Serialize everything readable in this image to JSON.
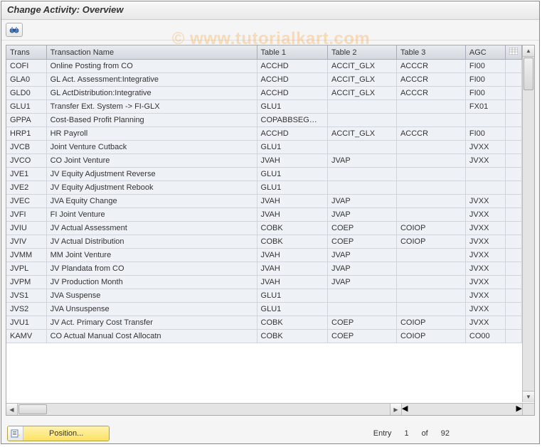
{
  "title": "Change Activity: Overview",
  "watermark": "© www.tutorialkart.com",
  "columns": {
    "trans": "Trans",
    "name": "Transaction Name",
    "t1": "Table 1",
    "t2": "Table 2",
    "t3": "Table 3",
    "agc": "AGC"
  },
  "rows": [
    {
      "trans": "COFI",
      "name": "Online Posting from CO",
      "t1": "ACCHD",
      "t2": "ACCIT_GLX",
      "t3": "ACCCR",
      "agc": "FI00"
    },
    {
      "trans": "GLA0",
      "name": "GL Act. Assessment:Integrative",
      "t1": "ACCHD",
      "t2": "ACCIT_GLX",
      "t3": "ACCCR",
      "agc": "FI00"
    },
    {
      "trans": "GLD0",
      "name": "GL ActDistribution:Integrative",
      "t1": "ACCHD",
      "t2": "ACCIT_GLX",
      "t3": "ACCCR",
      "agc": "FI00"
    },
    {
      "trans": "GLU1",
      "name": "Transfer Ext. System -> FI-GLX",
      "t1": "GLU1",
      "t2": "",
      "t3": "",
      "agc": "FX01"
    },
    {
      "trans": "GPPA",
      "name": "Cost-Based Profit Planning",
      "t1": "COPABBSEG…",
      "t2": "",
      "t3": "",
      "agc": ""
    },
    {
      "trans": "HRP1",
      "name": "HR Payroll",
      "t1": "ACCHD",
      "t2": "ACCIT_GLX",
      "t3": "ACCCR",
      "agc": "FI00"
    },
    {
      "trans": "JVCB",
      "name": "Joint Venture Cutback",
      "t1": "GLU1",
      "t2": "",
      "t3": "",
      "agc": "JVXX"
    },
    {
      "trans": "JVCO",
      "name": "CO Joint Venture",
      "t1": "JVAH",
      "t2": "JVAP",
      "t3": "",
      "agc": "JVXX"
    },
    {
      "trans": "JVE1",
      "name": "JV Equity Adjustment Reverse",
      "t1": "GLU1",
      "t2": "",
      "t3": "",
      "agc": ""
    },
    {
      "trans": "JVE2",
      "name": "JV Equity Adjustment Rebook",
      "t1": "GLU1",
      "t2": "",
      "t3": "",
      "agc": ""
    },
    {
      "trans": "JVEC",
      "name": "JVA Equity Change",
      "t1": "JVAH",
      "t2": "JVAP",
      "t3": "",
      "agc": "JVXX"
    },
    {
      "trans": "JVFI",
      "name": "FI Joint Venture",
      "t1": "JVAH",
      "t2": "JVAP",
      "t3": "",
      "agc": "JVXX"
    },
    {
      "trans": "JVIU",
      "name": "JV Actual Assessment",
      "t1": "COBK",
      "t2": "COEP",
      "t3": "COIOP",
      "agc": "JVXX"
    },
    {
      "trans": "JVIV",
      "name": "JV Actual Distribution",
      "t1": "COBK",
      "t2": "COEP",
      "t3": "COIOP",
      "agc": "JVXX"
    },
    {
      "trans": "JVMM",
      "name": "MM Joint Venture",
      "t1": "JVAH",
      "t2": "JVAP",
      "t3": "",
      "agc": "JVXX"
    },
    {
      "trans": "JVPL",
      "name": "JV Plandata from CO",
      "t1": "JVAH",
      "t2": "JVAP",
      "t3": "",
      "agc": "JVXX"
    },
    {
      "trans": "JVPM",
      "name": "JV Production Month",
      "t1": "JVAH",
      "t2": "JVAP",
      "t3": "",
      "agc": "JVXX"
    },
    {
      "trans": "JVS1",
      "name": "JVA Suspense",
      "t1": "GLU1",
      "t2": "",
      "t3": "",
      "agc": "JVXX"
    },
    {
      "trans": "JVS2",
      "name": "JVA Unsuspense",
      "t1": "GLU1",
      "t2": "",
      "t3": "",
      "agc": "JVXX"
    },
    {
      "trans": "JVU1",
      "name": "JV Act. Primary Cost Transfer",
      "t1": "COBK",
      "t2": "COEP",
      "t3": "COIOP",
      "agc": "JVXX"
    },
    {
      "trans": "KAMV",
      "name": "CO Actual Manual Cost Allocatn",
      "t1": "COBK",
      "t2": "COEP",
      "t3": "COIOP",
      "agc": "CO00"
    }
  ],
  "footer": {
    "position_label": "Position...",
    "entry_label": "Entry",
    "current": "1",
    "of_label": "of",
    "total": "92"
  }
}
